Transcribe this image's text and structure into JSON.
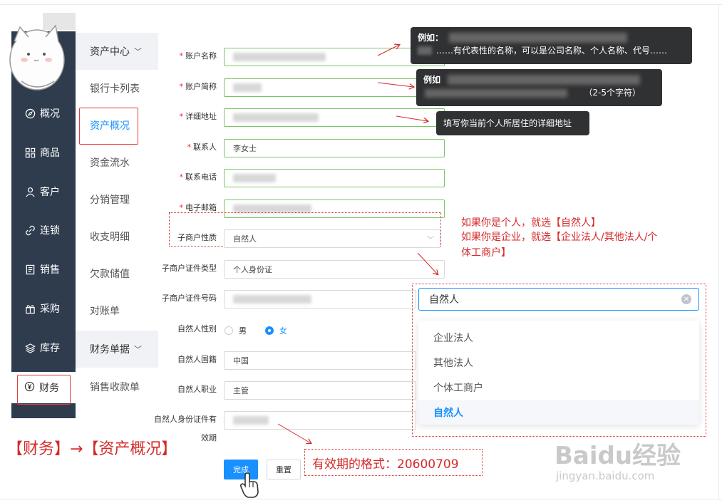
{
  "nav": {
    "items": [
      {
        "label": "概况",
        "icon": "compass-icon"
      },
      {
        "label": "商品",
        "icon": "grid-icon"
      },
      {
        "label": "客户",
        "icon": "user-icon"
      },
      {
        "label": "连锁",
        "icon": "link-icon"
      },
      {
        "label": "销售",
        "icon": "document-icon"
      },
      {
        "label": "采购",
        "icon": "gift-icon"
      },
      {
        "label": "库存",
        "icon": "layers-icon"
      }
    ],
    "finance": {
      "label": "财务",
      "icon": "yen-icon"
    }
  },
  "submenu": {
    "group1": "资产中心",
    "items1": [
      "银行卡列表",
      "资产概况",
      "资金流水",
      "分销管理",
      "收支明细",
      "欠款储值",
      "对账单"
    ],
    "group2": "财务单据",
    "items2": [
      "销售收款单"
    ]
  },
  "form": {
    "account_name": "账户名称",
    "account_short": "账户简称",
    "address": "详细地址",
    "contact": "联系人",
    "contact_value": "李女士",
    "phone": "联系电话",
    "email": "电子邮箱",
    "merchant_type": "子商户性质",
    "merchant_type_value": "自然人",
    "id_type": "子商户证件类型",
    "id_type_value": "个人身份证",
    "id_number": "子商户证件号码",
    "gender": "自然人性别",
    "gender_male": "男",
    "gender_female": "女",
    "nationality": "自然人国籍",
    "nationality_value": "中国",
    "occupation": "自然人职业",
    "occupation_value": "主管",
    "id_validity_line1": "自然人身份证件有",
    "id_validity_line2": "效期",
    "submit": "完成",
    "reset": "重置"
  },
  "tooltips": {
    "t1_title": "例如：",
    "t1_body": "……有代表性的名称，可以是公司名称、个人名称、代号……",
    "t2_title": "例如",
    "t2_body": "（2-5个字符）",
    "t3": "填写你当前个人所居住的详细地址"
  },
  "dropdown": {
    "value": "自然人",
    "options": [
      "企业法人",
      "其他法人",
      "个体工商户",
      "自然人"
    ]
  },
  "annotations": {
    "note_line1": "如果你是个人，就选【自然人】",
    "note_line2": "如果你是企业，就选【企业法人/其他法人/个",
    "note_line3": "体工商户】",
    "path": "【财务】→【资产概况】",
    "date_format": "有效期的格式：20600709"
  },
  "watermark": {
    "brand": "Baidu经验",
    "url": "jingyan.baidu.com"
  },
  "colors": {
    "nav_bg": "#2f3c4e",
    "accent": "#1890ff",
    "annotation": "#d42a2a",
    "input_border": "#7cc56b"
  }
}
